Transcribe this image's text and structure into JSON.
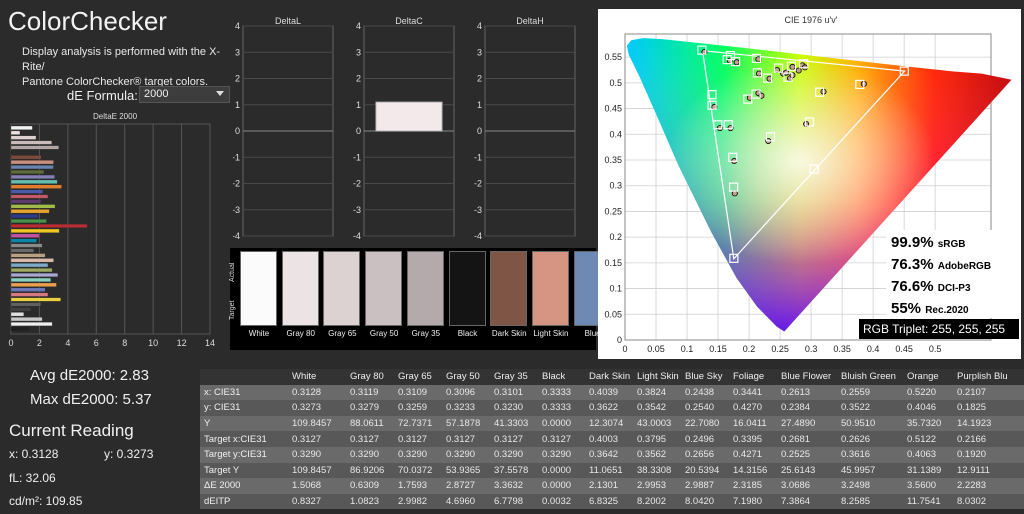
{
  "app": {
    "title": "ColorChecker",
    "description_line1": "Display analysis is performed with the X-Rite/",
    "description_line2": "Pantone ColorChecker® target colors."
  },
  "formula": {
    "label": "dE Formula:",
    "value": "2000"
  },
  "deltae_chart": {
    "title": "DeltaE 2000",
    "ticks": [
      "0",
      "2",
      "4",
      "6",
      "8",
      "10",
      "12",
      "14"
    ],
    "bars": [
      {
        "value": 1.5068,
        "color": "#f2f2f2"
      },
      {
        "value": 0.6309,
        "color": "#ebe1e0"
      },
      {
        "value": 1.7593,
        "color": "#ddd0cf"
      },
      {
        "value": 2.8727,
        "color": "#c9bbba"
      },
      {
        "value": 3.3632,
        "color": "#b3a6a6"
      },
      {
        "value": 0.0,
        "color": "#111111"
      },
      {
        "value": 2.1301,
        "color": "#7a4a3c"
      },
      {
        "value": 2.9953,
        "color": "#c99080"
      },
      {
        "value": 2.9887,
        "color": "#6a84b0"
      },
      {
        "value": 2.3185,
        "color": "#5d6e3c"
      },
      {
        "value": 3.0686,
        "color": "#8480b4"
      },
      {
        "value": 3.2498,
        "color": "#63bfb0"
      },
      {
        "value": 3.56,
        "color": "#e07e2e"
      },
      {
        "value": 2.2283,
        "color": "#4a5aa8"
      },
      {
        "value": 2.6,
        "color": "#c25868"
      },
      {
        "value": 2.1,
        "color": "#5c3c6c"
      },
      {
        "value": 3.1,
        "color": "#a0bc48"
      },
      {
        "value": 2.7,
        "color": "#e6a42e"
      },
      {
        "value": 1.9,
        "color": "#2e3c90"
      },
      {
        "value": 2.5,
        "color": "#48944a"
      },
      {
        "value": 5.37,
        "color": "#b42e34"
      },
      {
        "value": 3.4,
        "color": "#eec724"
      },
      {
        "value": 2.0,
        "color": "#c054a0"
      },
      {
        "value": 1.8,
        "color": "#0b86a8"
      },
      {
        "value": 2.2,
        "color": "#8a8a8a"
      },
      {
        "value": 1.6,
        "color": "#6a6a6a"
      },
      {
        "value": 2.4,
        "color": "#b8a080"
      },
      {
        "value": 3.0,
        "color": "#d8b8a8"
      },
      {
        "value": 2.6,
        "color": "#7ea8c8"
      },
      {
        "value": 2.9,
        "color": "#9ca860"
      },
      {
        "value": 3.3,
        "color": "#a8a8d0"
      },
      {
        "value": 2.8,
        "color": "#88d0c0"
      },
      {
        "value": 3.2,
        "color": "#e8a050"
      },
      {
        "value": 2.4,
        "color": "#6878b8"
      },
      {
        "value": 2.6,
        "color": "#d87880"
      },
      {
        "value": 3.5,
        "color": "#e8d040"
      },
      {
        "value": 2.1,
        "color": "#606060"
      },
      {
        "value": 1.4,
        "color": "#404040"
      },
      {
        "value": 0.9,
        "color": "#e0e0e0"
      },
      {
        "value": 2.2,
        "color": "#c8c8c8"
      },
      {
        "value": 2.9,
        "color": "#f0f0f0"
      },
      {
        "value": 1.3,
        "color": "#202020"
      }
    ]
  },
  "delta_charts": [
    {
      "title": "DeltaL",
      "ticks": [
        "4",
        "3",
        "2",
        "1",
        "0",
        "-1",
        "-2",
        "-3",
        "-4"
      ],
      "bar": null
    },
    {
      "title": "DeltaC",
      "ticks": [
        "4",
        "3",
        "2",
        "1",
        "0",
        "-1",
        "-2",
        "-3",
        "-4"
      ],
      "bar": {
        "from": 0,
        "to": 1.1
      }
    },
    {
      "title": "DeltaH",
      "ticks": [
        "4",
        "3",
        "2",
        "1",
        "0",
        "-1",
        "-2",
        "-3",
        "-4"
      ],
      "bar": null
    }
  ],
  "swatches": {
    "actual_label": "Actual",
    "target_label": "Target",
    "items": [
      {
        "label": "White",
        "color": "#fbfbfb"
      },
      {
        "label": "Gray 80",
        "color": "#ece4e4"
      },
      {
        "label": "Gray 65",
        "color": "#dcd2d2"
      },
      {
        "label": "Gray 50",
        "color": "#cac0c1"
      },
      {
        "label": "Gray 35",
        "color": "#b5aaab"
      },
      {
        "label": "Black",
        "color": "#141414"
      },
      {
        "label": "Dark Skin",
        "color": "#7f5546"
      },
      {
        "label": "Light Skin",
        "color": "#d59582"
      },
      {
        "label": "Blue",
        "color": "#6f89b5"
      }
    ]
  },
  "cie": {
    "title": "CIE 1976 u'v'",
    "x_ticks": [
      "0",
      "0.05",
      "0.1",
      "0.15",
      "0.2",
      "0.25",
      "0.3",
      "0.35",
      "0.4",
      "0.45",
      "0.5"
    ],
    "y_ticks": [
      "0.55",
      "0.5",
      "0.45",
      "0.4",
      "0.35",
      "0.3",
      "0.25",
      "0.2",
      "0.15",
      "0.1",
      "0.05",
      "0"
    ],
    "coverage": [
      {
        "percent": "99.9%",
        "space": "sRGB"
      },
      {
        "percent": "76.3%",
        "space": "AdobeRGB"
      },
      {
        "percent": "76.6%",
        "space": "DCI-P3"
      },
      {
        "percent": "55%",
        "space": "Rec.2020"
      }
    ],
    "rgb_triplet": "RGB Triplet: 255, 255, 255",
    "targets": [
      [
        0.1979,
        0.4683
      ],
      [
        0.2112,
        0.4782
      ],
      [
        0.2299,
        0.5092
      ],
      [
        0.1665,
        0.4186
      ],
      [
        0.2135,
        0.5195
      ],
      [
        0.1404,
        0.4565
      ],
      [
        0.2628,
        0.5112
      ],
      [
        0.1495,
        0.4185
      ],
      [
        0.3137,
        0.4819
      ],
      [
        0.2346,
        0.3951
      ],
      [
        0.1648,
        0.5452
      ],
      [
        0.2684,
        0.5324
      ],
      [
        0.1737,
        0.3552
      ],
      [
        0.1239,
        0.5637
      ],
      [
        0.3785,
        0.4969
      ],
      [
        0.212,
        0.5476
      ],
      [
        0.2974,
        0.4239
      ],
      [
        0.1751,
        0.2973
      ],
      [
        0.1783,
        0.5413
      ],
      [
        0.4502,
        0.5228
      ],
      [
        0.17,
        0.553
      ],
      [
        0.305,
        0.3324
      ],
      [
        0.1755,
        0.1588
      ],
      [
        0.1402,
        0.477
      ],
      [
        0.2475,
        0.5287
      ],
      [
        0.2882,
        0.5371
      ]
    ],
    "measured": [
      [
        0.2012,
        0.471
      ],
      [
        0.215,
        0.48
      ],
      [
        0.233,
        0.508
      ],
      [
        0.17,
        0.412
      ],
      [
        0.216,
        0.518
      ],
      [
        0.144,
        0.453
      ],
      [
        0.266,
        0.509
      ],
      [
        0.153,
        0.412
      ],
      [
        0.32,
        0.483
      ],
      [
        0.231,
        0.387
      ],
      [
        0.169,
        0.543
      ],
      [
        0.27,
        0.531
      ],
      [
        0.176,
        0.348
      ],
      [
        0.128,
        0.56
      ],
      [
        0.385,
        0.498
      ],
      [
        0.215,
        0.546
      ],
      [
        0.292,
        0.42
      ],
      [
        0.177,
        0.285
      ],
      [
        0.18,
        0.54
      ],
      [
        0.245,
        0.525
      ],
      [
        0.286,
        0.534
      ],
      [
        0.255,
        0.518
      ],
      [
        0.27,
        0.515
      ],
      [
        0.28,
        0.524
      ],
      [
        0.22,
        0.475
      ],
      [
        0.29,
        0.53
      ],
      [
        0.26,
        0.52
      ]
    ]
  },
  "stats": {
    "avg": "Avg dE2000: 2.83",
    "max": "Max dE2000: 5.37",
    "current_title": "Current Reading",
    "x": "x: 0.3128",
    "y": "y: 0.3273",
    "fl": "fL: 32.06",
    "cdm2": "cd/m²: 109.85"
  },
  "table": {
    "headers": [
      "",
      "White",
      "Gray 80",
      "Gray 65",
      "Gray 50",
      "Gray 35",
      "Black",
      "Dark Skin",
      "Light Skin",
      "Blue Sky",
      "Foliage",
      "Blue Flower",
      "Bluish Green",
      "Orange",
      "Purplish Blu"
    ],
    "rows": [
      [
        "x: CIE31",
        "0.3128",
        "0.3119",
        "0.3109",
        "0.3096",
        "0.3101",
        "0.3333",
        "0.4039",
        "0.3824",
        "0.2438",
        "0.3441",
        "0.2613",
        "0.2559",
        "0.5220",
        "0.2107"
      ],
      [
        "y: CIE31",
        "0.3273",
        "0.3279",
        "0.3259",
        "0.3233",
        "0.3230",
        "0.3333",
        "0.3622",
        "0.3542",
        "0.2540",
        "0.4270",
        "0.2384",
        "0.3522",
        "0.4046",
        "0.1825"
      ],
      [
        "Y",
        "109.8457",
        "88.0611",
        "72.7371",
        "57.1878",
        "41.3303",
        "0.0000",
        "12.3074",
        "43.0003",
        "22.7080",
        "16.0411",
        "27.4890",
        "50.9510",
        "35.7320",
        "14.1923"
      ],
      [
        "Target x:CIE31",
        "0.3127",
        "0.3127",
        "0.3127",
        "0.3127",
        "0.3127",
        "0.3127",
        "0.4003",
        "0.3795",
        "0.2496",
        "0.3395",
        "0.2681",
        "0.2626",
        "0.5122",
        "0.2166"
      ],
      [
        "Target y:CIE31",
        "0.3290",
        "0.3290",
        "0.3290",
        "0.3290",
        "0.3290",
        "0.3290",
        "0.3642",
        "0.3562",
        "0.2656",
        "0.4271",
        "0.2525",
        "0.3616",
        "0.4063",
        "0.1920"
      ],
      [
        "Target Y",
        "109.8457",
        "86.9206",
        "70.0372",
        "53.9365",
        "37.5578",
        "0.0000",
        "11.0651",
        "38.3308",
        "20.5394",
        "14.3156",
        "25.6143",
        "45.9957",
        "31.1389",
        "12.9111"
      ],
      [
        "ΔE 2000",
        "1.5068",
        "0.6309",
        "1.7593",
        "2.8727",
        "3.3632",
        "0.0000",
        "2.1301",
        "2.9953",
        "2.9887",
        "2.3185",
        "3.0686",
        "3.2498",
        "3.5600",
        "2.2283"
      ],
      [
        "dEITP",
        "0.8327",
        "1.0823",
        "2.9982",
        "4.6960",
        "6.7798",
        "0.0032",
        "6.8325",
        "8.2002",
        "8.0420",
        "7.1980",
        "7.3864",
        "8.2585",
        "11.7541",
        "8.0302"
      ]
    ]
  }
}
